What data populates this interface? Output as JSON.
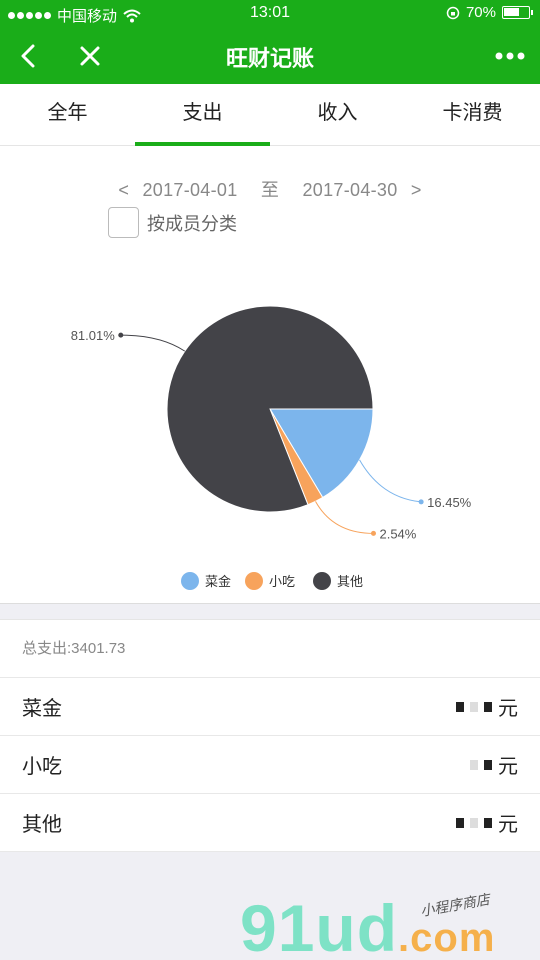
{
  "status_bar": {
    "carrier": "中国移动",
    "time": "13:01",
    "battery": "70%",
    "battery_level": 0.7
  },
  "navbar": {
    "title": "旺财记账"
  },
  "tabs": [
    {
      "label": "全年",
      "active": false
    },
    {
      "label": "支出",
      "active": true
    },
    {
      "label": "收入",
      "active": false
    },
    {
      "label": "卡消费",
      "active": false
    }
  ],
  "filter": {
    "prev": "<",
    "start_date": "2017-04-01",
    "to": "至",
    "end_date": "2017-04-30",
    "next": ">",
    "member_label": "按成员分类"
  },
  "chart_data": {
    "type": "pie",
    "categories": [
      "菜金",
      "小吃",
      "其他"
    ],
    "values": [
      16.45,
      2.54,
      81.01
    ],
    "labels": [
      "16.45%",
      "2.54%",
      "81.01%"
    ],
    "colors": [
      "#7cb5ec",
      "#f7a35c",
      "#434348"
    ],
    "legend_position": "bottom"
  },
  "summary": {
    "total": "总支出:3401.73",
    "rows": [
      {
        "name": "菜金",
        "unit": "元"
      },
      {
        "name": "小吃",
        "unit": "元"
      },
      {
        "name": "其他",
        "unit": "元"
      }
    ]
  },
  "watermark": {
    "brand": "91ud",
    "domain": ".com",
    "tagline": "小程序商店"
  }
}
